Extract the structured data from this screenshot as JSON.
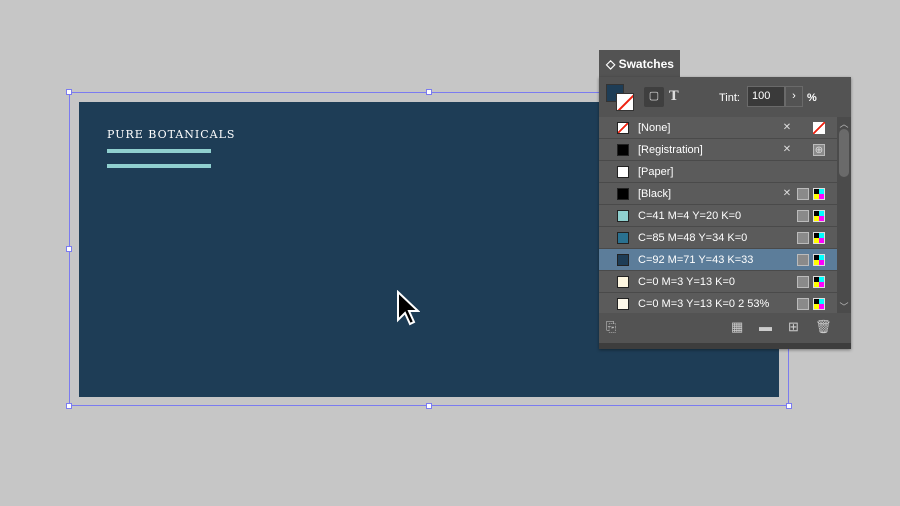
{
  "document": {
    "brand_text": "PURE BOTANICALS",
    "page_color": "#1e3d56",
    "accent_color": "#8fd0cf"
  },
  "panel": {
    "title": "Swatches",
    "tint_label": "Tint:",
    "tint_value": "100",
    "tint_unit": "%",
    "swatches": [
      {
        "name": "[None]",
        "color": "none",
        "icons": [
          "no-edit",
          "none"
        ]
      },
      {
        "name": "[Registration]",
        "color": "#000000",
        "icons": [
          "no-edit",
          "registration"
        ]
      },
      {
        "name": "[Paper]",
        "color": "#ffffff",
        "icons": []
      },
      {
        "name": "[Black]",
        "color": "#000000",
        "icons": [
          "no-edit",
          "process",
          "cmyk"
        ]
      },
      {
        "name": "C=41 M=4 Y=20 K=0",
        "color": "#8fd0cf",
        "icons": [
          "process",
          "cmyk"
        ]
      },
      {
        "name": "C=85 M=48 Y=34 K=0",
        "color": "#2a7190",
        "icons": [
          "process",
          "cmyk"
        ]
      },
      {
        "name": "C=92 M=71 Y=43 K=33",
        "color": "#1e3d56",
        "icons": [
          "process",
          "cmyk"
        ],
        "selected": true
      },
      {
        "name": "C=0 M=3 Y=13 K=0",
        "color": "#fdf6e0",
        "icons": [
          "process",
          "cmyk"
        ]
      },
      {
        "name": "C=0 M=3 Y=13 K=0 2 53%",
        "color": "#fdf8ea",
        "icons": [
          "process",
          "cmyk"
        ]
      }
    ]
  }
}
